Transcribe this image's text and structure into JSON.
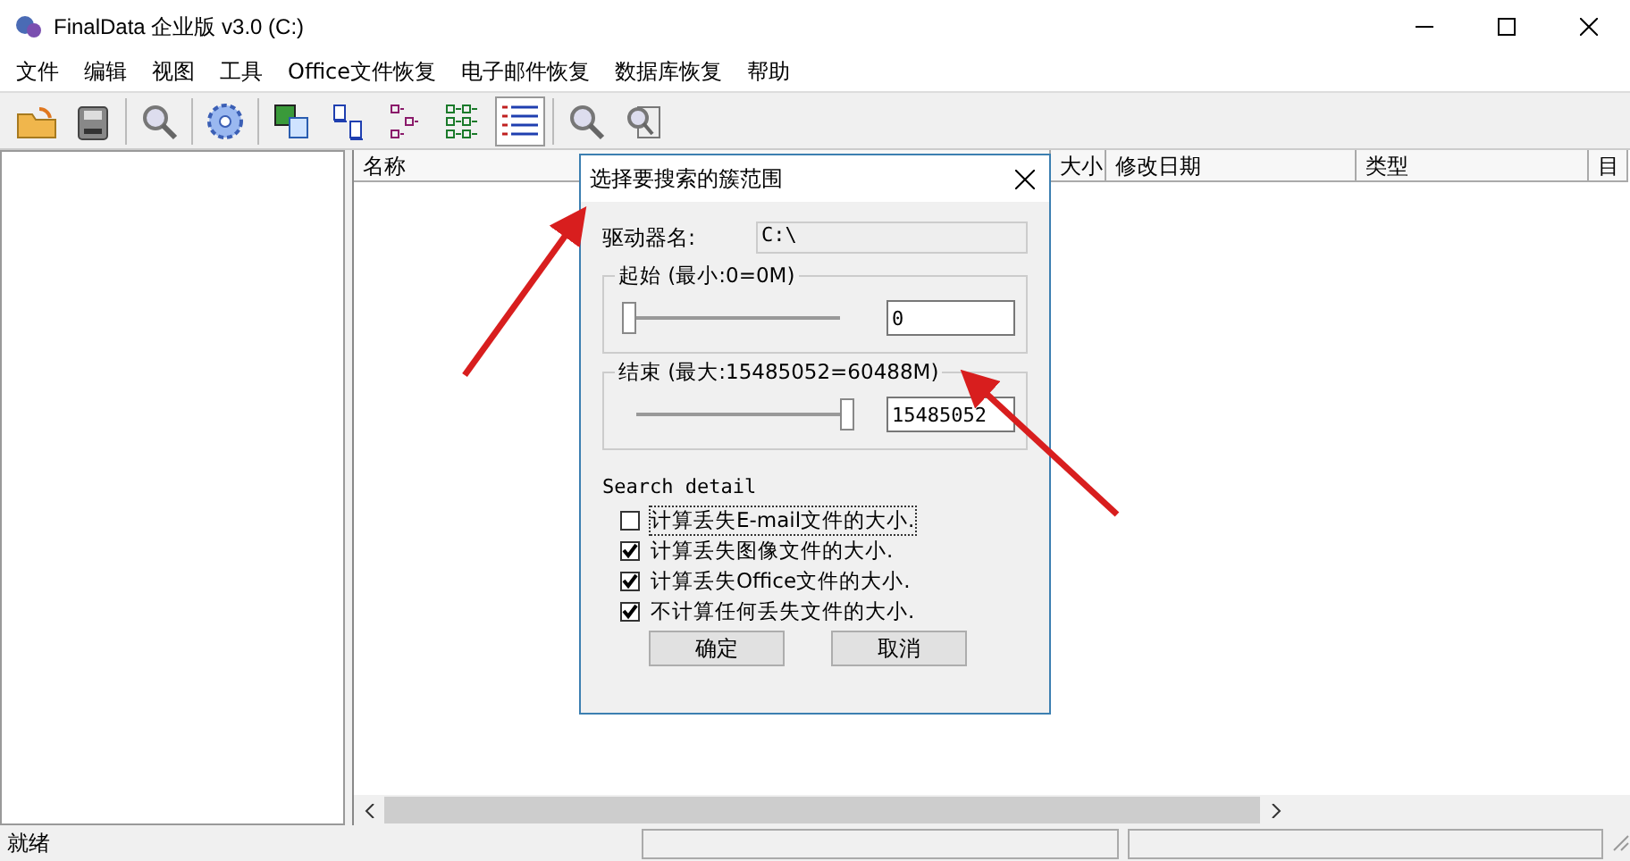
{
  "window": {
    "title": "FinalData 企业版 v3.0 (C:)"
  },
  "menu": [
    "文件",
    "编辑",
    "视图",
    "工具",
    "Office文件恢复",
    "电子邮件恢复",
    "数据库恢复",
    "帮助"
  ],
  "toolbar": [
    {
      "kind": "folder",
      "pressed": false
    },
    {
      "kind": "printer",
      "pressed": false
    },
    {
      "kind": "magnifier",
      "pressed": false
    },
    {
      "kind": "disc",
      "pressed": false
    },
    {
      "kind": "picture",
      "pressed": false
    },
    {
      "kind": "docs",
      "pressed": false
    },
    {
      "kind": "tree",
      "pressed": false
    },
    {
      "kind": "grid",
      "pressed": false
    },
    {
      "kind": "list",
      "pressed": true
    },
    {
      "kind": "magnifier",
      "pressed": false
    },
    {
      "kind": "finddoc",
      "pressed": false
    }
  ],
  "table": {
    "columns": [
      "名称",
      "大小",
      "修改日期",
      "类型",
      "目"
    ]
  },
  "dialog": {
    "title": "选择要搜索的簇范围",
    "drive_label": "驱动器名:",
    "drive_value": "C:\\",
    "start": {
      "label": "起始 (最小:0=0M)",
      "level": 0.0,
      "value": "0"
    },
    "end": {
      "label": "结束 (最大:15485052=60488M)",
      "level": 1.0,
      "value": "15485052"
    },
    "detail_title": "Search detail",
    "options": [
      {
        "label": "计算丢失E-mail文件的大小.",
        "checked": false,
        "focused": true
      },
      {
        "label": "计算丢失图像文件的大小.",
        "checked": true,
        "focused": false
      },
      {
        "label": "计算丢失Office文件的大小.",
        "checked": true,
        "focused": false
      },
      {
        "label": "不计算任何丢失文件的大小.",
        "checked": true,
        "focused": false
      }
    ],
    "buttons": [
      "确定",
      "取消"
    ]
  },
  "status_bar": {
    "text": "就绪"
  }
}
